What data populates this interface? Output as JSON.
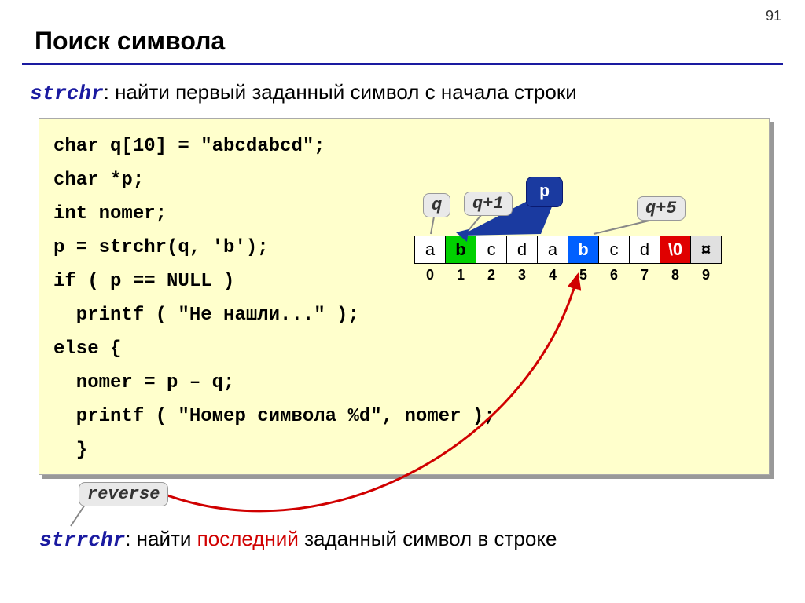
{
  "page_number": "91",
  "title": "Поиск символа",
  "subtitle": {
    "keyword": "strchr",
    "text": ": найти первый заданный символ c начала строки"
  },
  "code_lines": [
    "char q[10] = \"abcdabcd\";",
    "char *p;",
    "int nomer;",
    "p = strchr(q, 'b');",
    "if ( p == NULL )",
    "  printf ( \"Не нашли...\" );",
    "else {",
    "  nomer = p – q;",
    "  printf ( \"Номер символа %d\", nomer );",
    "  }"
  ],
  "callouts": {
    "q": "q",
    "q1": "q+1",
    "p": "p",
    "q5": "q+5",
    "reverse": "reverse"
  },
  "cells": [
    "a",
    "b",
    "c",
    "d",
    "a",
    "b",
    "c",
    "d",
    "\\0",
    "¤"
  ],
  "cell_styles": [
    "",
    "green",
    "",
    "",
    "",
    "blue",
    "",
    "",
    "red",
    "gray"
  ],
  "indices": [
    "0",
    "1",
    "2",
    "3",
    "4",
    "5",
    "6",
    "7",
    "8",
    "9"
  ],
  "footer": {
    "keyword": "strrchr",
    "before": ": найти ",
    "red": "последний",
    "after": " заданный символ в строке"
  }
}
